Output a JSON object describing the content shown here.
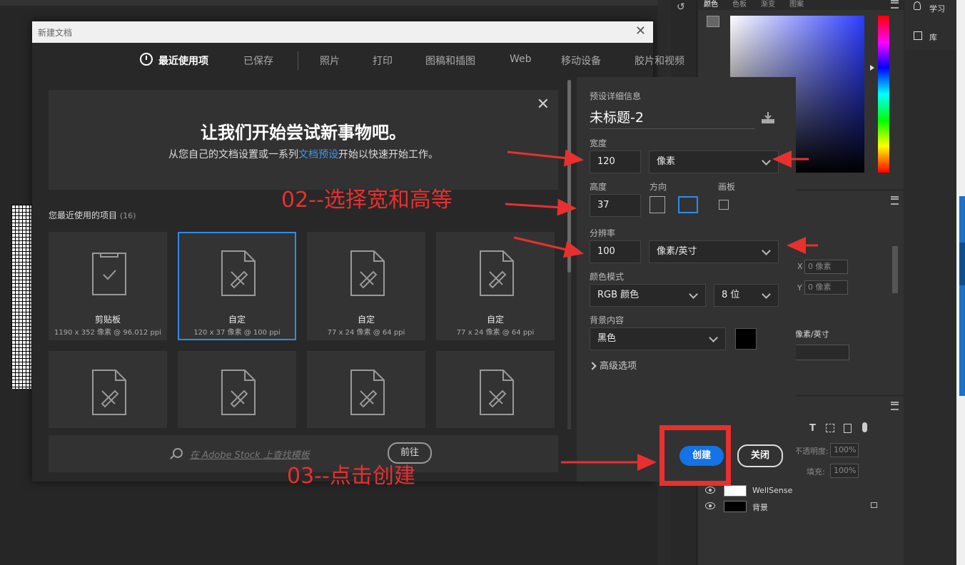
{
  "window": {
    "title": "新建文档"
  },
  "tabs": [
    "最近使用项",
    "已保存",
    "照片",
    "打印",
    "图稿和插图",
    "Web",
    "移动设备",
    "胶片和视频"
  ],
  "welcome": {
    "title": "让我们开始尝试新事物吧。",
    "subtitle_pre": "从您自己的文档设置或一系列",
    "subtitle_link": "文档预设",
    "subtitle_post": "开始以快速开始工作。"
  },
  "recent": {
    "label": "您最近使用的项目",
    "count": "(16)",
    "cards": [
      {
        "name": "剪贴板",
        "meta": "1190 x 352 像素 @ 96.012 ppi",
        "icon": "clipboard-check-icon",
        "selected": false
      },
      {
        "name": "自定",
        "meta": "120 x 37 像素 @ 100 ppi",
        "icon": "custom-document-icon",
        "selected": true
      },
      {
        "name": "自定",
        "meta": "77 x 24 像素 @ 64 ppi",
        "icon": "custom-document-icon",
        "selected": false
      },
      {
        "name": "自定",
        "meta": "77 x 24 像素 @ 64 ppi",
        "icon": "custom-document-icon",
        "selected": false
      }
    ]
  },
  "stock": {
    "placeholder": "在 Adobe Stock 上查找模板",
    "go_label": "前往"
  },
  "details": {
    "section_label": "预设详细信息",
    "doc_name": "未标题-2",
    "width_label": "宽度",
    "width_value": "120",
    "width_unit": "像素",
    "height_label": "高度",
    "height_value": "37",
    "orientation_label": "方向",
    "artboard_label": "画板",
    "resolution_label": "分辨率",
    "resolution_value": "100",
    "resolution_unit": "像素/英寸",
    "colormode_label": "颜色模式",
    "colormode_value": "RGB 颜色",
    "bitdepth_value": "8 位",
    "bg_label": "背景内容",
    "bg_value": "黑色",
    "bg_color": "#000000",
    "advanced_label": "高级选项",
    "create_label": "创建",
    "close_label": "关闭"
  },
  "annotations": {
    "step2": "02--选择宽和高等",
    "step3": "03--点击创建",
    "color": "#e8302f"
  },
  "ps_panels": {
    "color_tabs": [
      "颜色",
      "色板",
      "渐变",
      "图案"
    ],
    "learn": "学习",
    "library": "库",
    "props_x": "X",
    "props_y": "Y",
    "props_x_val": "0 像素",
    "props_y_val": "0 像素",
    "props_unit": "像素/英寸",
    "opacity_label": "不透明度:",
    "opacity_value": "100%",
    "fill_label": "填充:",
    "fill_value": "100%",
    "layers": [
      {
        "name": "WellSense",
        "locked": false
      },
      {
        "name": "背景",
        "locked": true
      }
    ]
  },
  "accent_color": "#1473e6"
}
